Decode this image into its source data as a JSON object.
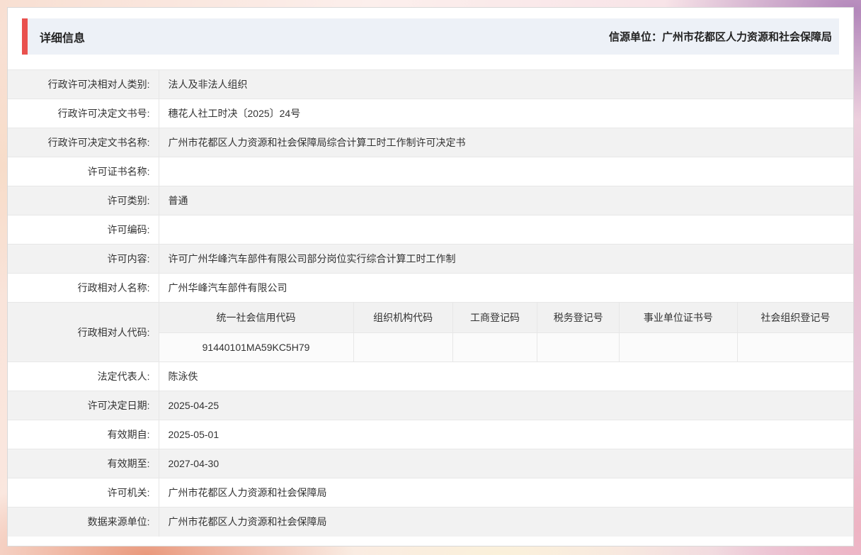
{
  "header": {
    "title": "详细信息",
    "source": "信源单位：广州市花都区人力资源和社会保障局"
  },
  "table": {
    "rows": [
      {
        "label": "行政许可决相对人类别:",
        "value": "法人及非法人组织"
      },
      {
        "label": "行政许可决定文书号:",
        "value": "穗花人社工时决〔2025〕24号"
      },
      {
        "label": "行政许可决定文书名称:",
        "value": "广州市花都区人力资源和社会保障局综合计算工时工作制许可决定书"
      },
      {
        "label": "许可证书名称:",
        "value": ""
      },
      {
        "label": "许可类别:",
        "value": "普通"
      },
      {
        "label": "许可编码:",
        "value": ""
      },
      {
        "label": "许可内容:",
        "value": "许可广州华峰汽车部件有限公司部分岗位实行综合计算工时工作制"
      },
      {
        "label": "行政相对人名称:",
        "value": "广州华峰汽车部件有限公司"
      }
    ],
    "code_row": {
      "label": "行政相对人代码:",
      "columns": [
        "统一社会信用代码",
        "组织机构代码",
        "工商登记码",
        "税务登记号",
        "事业单位证书号",
        "社会组织登记号"
      ],
      "credit_code": "91440101MA59KC5H79",
      "empty_values": [
        "",
        "",
        "",
        "",
        ""
      ]
    },
    "rows2": [
      {
        "label": "法定代表人:",
        "value": "陈泳佚"
      },
      {
        "label": "许可决定日期:",
        "value": "2025-04-25"
      },
      {
        "label": "有效期自:",
        "value": "2025-05-01"
      },
      {
        "label": "有效期至:",
        "value": "2027-04-30"
      },
      {
        "label": "许可机关:",
        "value": "广州市花都区人力资源和社会保障局"
      },
      {
        "label": "数据来源单位:",
        "value": "广州市花都区人力资源和社会保障局"
      }
    ]
  },
  "colors": {
    "accent_red": "#E9514E",
    "header_bar_bg": "#EDF1F7",
    "alt_row_bg": "#F2F2F2",
    "border": "#E7E7E7"
  }
}
